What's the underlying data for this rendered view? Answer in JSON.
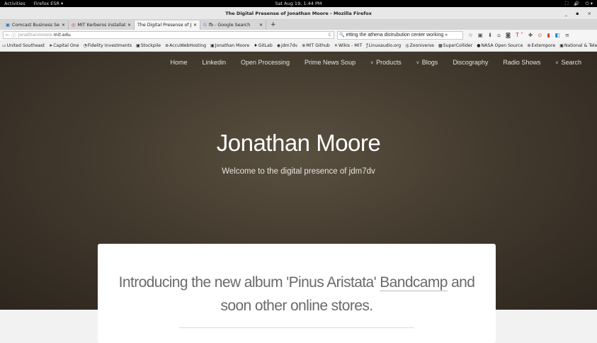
{
  "system": {
    "activities": "Activities",
    "app": "Firefox ESR ▾",
    "clock": "Sat Aug 19,  1:44 PM",
    "tray": [
      "⛶",
      "🔊",
      "⏻ ▾"
    ]
  },
  "window": {
    "title": "The Digital Presense of Jonathan Moore - Mozilla Firefox",
    "controls": [
      "_",
      "▪",
      "×"
    ]
  },
  "tabs": [
    {
      "label": "Comcast Business Se...",
      "icon": "▣"
    },
    {
      "label": "MIT Kerberos installat...",
      "icon": "◎"
    },
    {
      "label": "The Digital Presense of J...",
      "icon": ""
    },
    {
      "label": "fb - Google Search",
      "icon": "G"
    }
  ],
  "url": {
    "prefix": "jonathanmoore.",
    "host": "mit.edu",
    "reload": "C"
  },
  "search": {
    "value": "etting the athena distrubution center working »"
  },
  "toolbar_icons": [
    "☆",
    "▣",
    "⬇",
    "⌂",
    "◙",
    "T ˅",
    "✚",
    "⊘",
    "▮",
    "◧",
    "≡"
  ],
  "bookmarks": [
    "United Southeast",
    "Capital One",
    "Fidelity Investments",
    "Stockpile",
    "AccuWebHosting",
    "Jonathan Moore",
    "GitLab",
    "jdm7dv",
    "MIT Github",
    "Wikis - MIT",
    "Linuxaudio.org",
    "Zooniverse",
    "SuperCollider",
    "NASA Open Source",
    "Extempore",
    "National & Telecom Dat..."
  ],
  "bookmarks_more": "»",
  "site": {
    "nav": [
      {
        "label": "Home"
      },
      {
        "label": "Linkedin"
      },
      {
        "label": "Open Processing"
      },
      {
        "label": "Prime News Soup"
      },
      {
        "label": "Products",
        "dropdown": true
      },
      {
        "label": "Blogs",
        "dropdown": true
      },
      {
        "label": "Discography"
      },
      {
        "label": "Radio Shows"
      },
      {
        "label": "Search",
        "dropdown": true
      }
    ],
    "title": "Jonathan Moore",
    "subtitle": "Welcome to the digital presence of jdm7dv",
    "intro_before": "Introducing the new album 'Pinus Aristata' ",
    "intro_link": "Bandcamp",
    "intro_after": " and soon other online stores."
  }
}
